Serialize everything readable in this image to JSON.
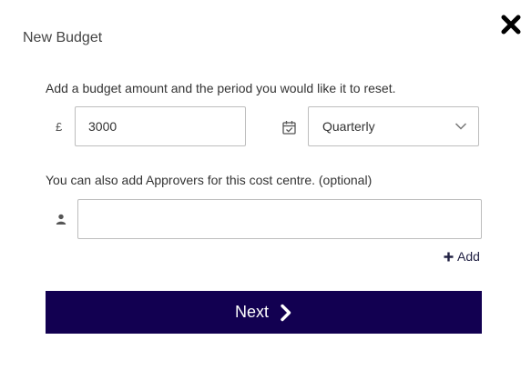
{
  "dialog": {
    "title": "New Budget"
  },
  "budget": {
    "intro_text": "Add a budget amount and the period you would like it to reset.",
    "currency_symbol": "£",
    "amount_value": "3000",
    "period_value": "Quarterly"
  },
  "approvers": {
    "label_text": "You can also add Approvers for this cost centre. (optional)",
    "input_value": "",
    "add_label": "Add"
  },
  "actions": {
    "next_label": "Next"
  },
  "colors": {
    "primary": "#120051",
    "border": "#bdbdbd"
  },
  "icons": {
    "close": "close-icon",
    "calendar": "calendar-check-icon",
    "dropdown": "chevron-down-icon",
    "person": "person-icon",
    "plus": "plus-icon",
    "next": "chevron-right-icon"
  }
}
